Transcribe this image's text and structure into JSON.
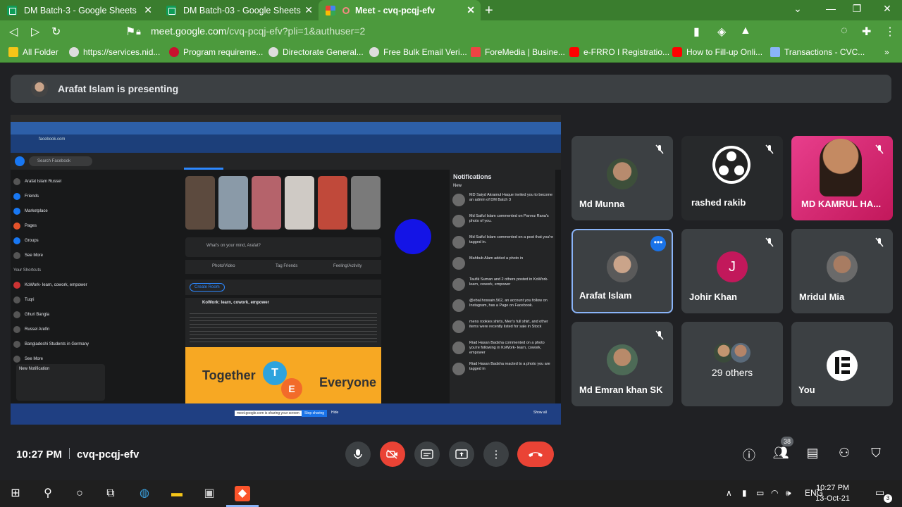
{
  "browser": {
    "tabs": [
      {
        "title": "DM Batch-3 - Google Sheets",
        "icon": "sheets-icon"
      },
      {
        "title": "DM Batch-03 - Google Sheets",
        "icon": "sheets-icon"
      },
      {
        "title": "Meet - cvq-pcqj-efv",
        "icon": "meet-icon",
        "active": true
      }
    ],
    "url_host": "meet.google.com",
    "url_path": "/cvq-pcqj-efv?pli=1&authuser=2",
    "bookmarks": [
      "All Folder",
      "https://services.nid...",
      "Program requireme...",
      "Directorate General...",
      "Free Bulk Email Veri...",
      "ForeMedia | Busine...",
      "e-FRRO I Registratio...",
      "How to Fill-up Onli...",
      "Transactions - CVC..."
    ],
    "accent": "#4c9a3d"
  },
  "meet": {
    "presenting_text": "Arafat Islam is presenting",
    "participants": [
      {
        "name": "Md Munna",
        "muted": true
      },
      {
        "name": "rashed rakib",
        "muted": true
      },
      {
        "name": "MD KAMRUL HA...",
        "muted": true
      },
      {
        "name": "Arafat Islam",
        "muted": false,
        "active": true
      },
      {
        "name": "Johir Khan",
        "muted": true,
        "initial": "J"
      },
      {
        "name": "Mridul Mia",
        "muted": true
      },
      {
        "name": "Md Emran khan SK",
        "muted": true
      },
      {
        "name": "29 others",
        "muted": false
      },
      {
        "name": "You",
        "muted": false
      }
    ],
    "time": "10:27 PM",
    "meeting_code": "cvq-pcqj-efv",
    "participant_count": "38"
  },
  "shared_screen": {
    "fb_search": "Search Facebook",
    "left_menu": [
      "Arafat Islam Russel",
      "Friends",
      "Marketplace",
      "Pages",
      "Groups",
      "See More",
      "Your Shortcuts",
      "KoWork- learn, cowork, empower",
      "Tuqri",
      "Ghuri Bangla",
      "Russel Arefin",
      "Bangladeshi Students in Germany",
      "See More"
    ],
    "new_notification": "New Notification",
    "notifications_title": "Notifications",
    "notif_new": "New",
    "notifications": [
      "MD Saiyd Akramul Haque invited you to become an admin of DM Batch 3",
      "Md Saiful Islam commented on Parvez Rana's photo of you.",
      "Md Saiful Islam commented on a post that you're tagged in.",
      "Mahbub Alam added a photo in",
      "Taufik Suman and 2 others posted in KoWork- learn, cowork, empower",
      "@ebal.hossain.562, an account you follow on Instagram, has a Page on Facebook.",
      "mens rookies shirts, Men's full shirt, and other items were recently listed for sale in Stock",
      "Riad Hasan Badsha commented on a photo you're following in KoWork- learn, cowork, empower",
      "Riad Hasan Badsha reacted to a photo you are tagged in"
    ],
    "whats_on_mind": "What's on your mind, Arafat?",
    "post_actions": [
      "Photo/Video",
      "Tag Friends",
      "Feeling/Activity"
    ],
    "create_room": "Create Room",
    "post_author": "KoWork: learn, cowork, empower",
    "banner_words": [
      "Together",
      "T",
      "E",
      "Everyone"
    ],
    "sharing_text": "meet.google.com is sharing your screen",
    "stop_sharing": "Stop sharing",
    "hide": "Hide",
    "show_all": "Show all"
  },
  "taskbar": {
    "time": "10:27 PM",
    "date": "13-Oct-21",
    "lang": "ENG",
    "notif_count": "3"
  }
}
